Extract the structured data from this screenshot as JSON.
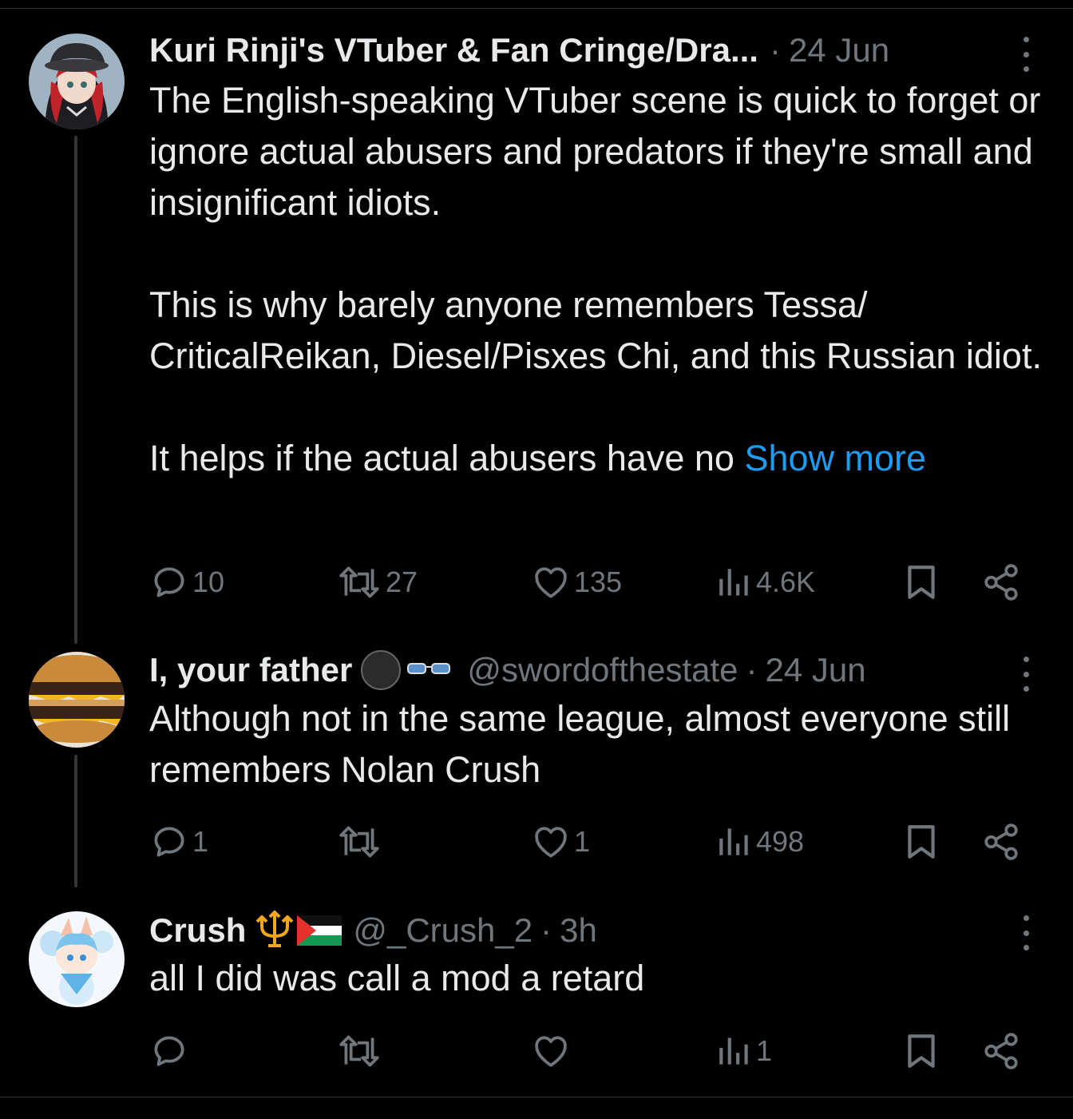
{
  "tweets": [
    {
      "name": "Kuri Rinji's VTuber & Fan Cringe/Dra...",
      "handle": "",
      "time": "24 Jun",
      "paragraphs": [
        "The English-speaking VTuber scene is quick to forget or ignore actual abusers and predators if they're small and insignificant idiots.",
        "This is why barely anyone remembers Tessa/ CriticalReikan, Diesel/Pisxes Chi, and this Russian idiot.",
        "It helps if the actual abusers have no "
      ],
      "show_more": "Show more",
      "replies": "10",
      "reposts": "27",
      "likes": "135",
      "views": "4.6K"
    },
    {
      "name": "I, your father",
      "badge_icons": [
        "black-circle-icon",
        "sunglasses-icon"
      ],
      "handle": "@swordofthestate",
      "time": "24 Jun",
      "text": "Although not in the same league, almost everyone still remembers Nolan Crush",
      "replies": "1",
      "reposts": "",
      "likes": "1",
      "views": "498"
    },
    {
      "name": "Crush",
      "badge_icons": [
        "trident-icon",
        "palestine-flag-icon"
      ],
      "handle": "@_Crush_2",
      "time": "3h",
      "text": "all I did was call a mod a retard",
      "replies": "",
      "reposts": "",
      "likes": "",
      "views": "1"
    }
  ],
  "separator": "·",
  "colors": {
    "background": "#000000",
    "text": "#e7e9ea",
    "muted": "#71767b",
    "link": "#1d9bf0",
    "thread_line": "#333639"
  }
}
